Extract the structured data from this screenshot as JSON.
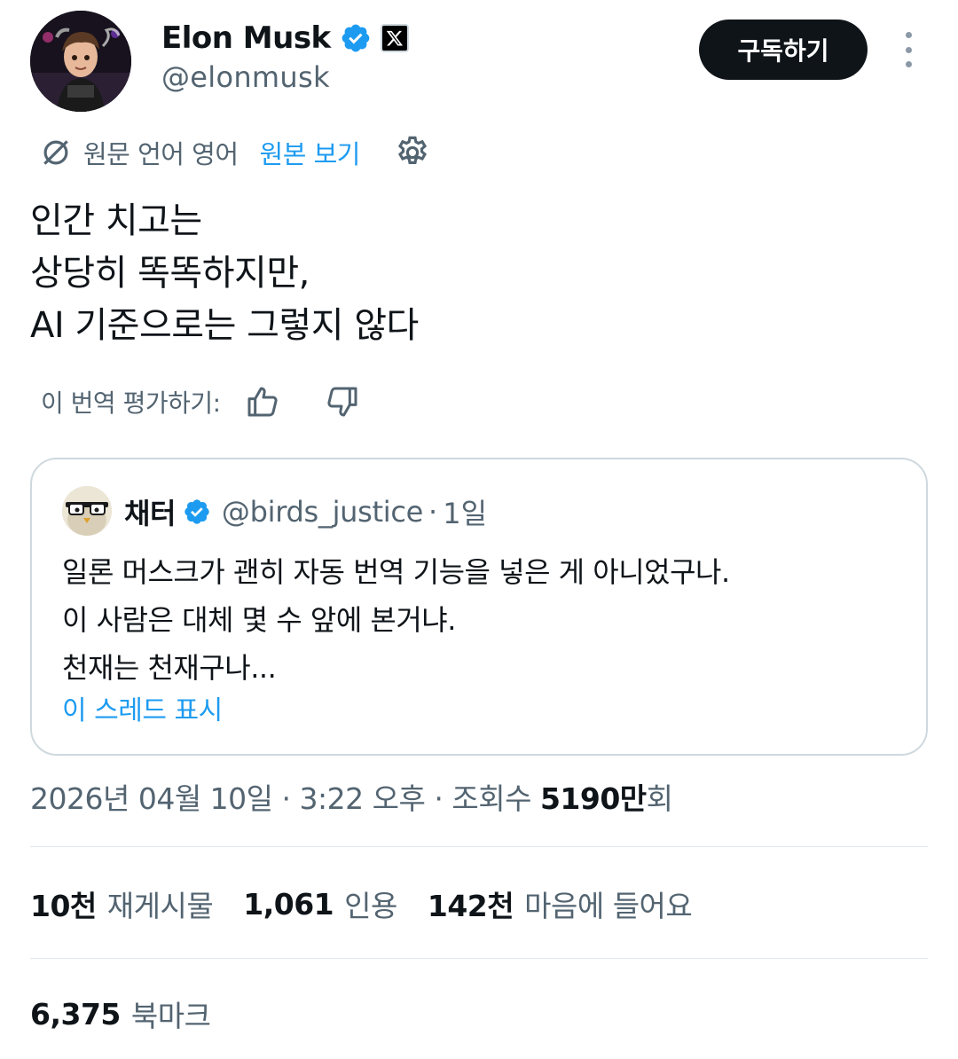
{
  "author": {
    "name": "Elon Musk",
    "handle": "@elonmusk",
    "verified": true,
    "affiliate_badge": "x-logo-icon"
  },
  "header": {
    "subscribe_label": "구독하기",
    "more_icon": "more-vertical-icon"
  },
  "translation": {
    "source_language": "원문 언어 영어",
    "show_original": "원본 보기",
    "rate_label": "이 번역 평가하기:"
  },
  "tweet": {
    "lines": [
      "인간 치고는",
      "상당히 똑똑하지만,",
      "AI 기준으로는 그렇지 않다"
    ]
  },
  "quote": {
    "name": "채터",
    "handle": "@birds_justice",
    "separator": "·",
    "time": "1일",
    "verified": true,
    "lines": [
      "일론 머스크가 괜히 자동 번역 기능을 넣은 게 아니었구나.",
      "이 사람은 대체 몇 수 앞에 본거냐.",
      "천재는 천재구나..."
    ],
    "show_thread": "이 스레드 표시"
  },
  "meta": {
    "date": "2026년 04월 10일",
    "separator": "·",
    "time": "3:22 오후",
    "views_label": "조회수",
    "views_value": "5190만",
    "views_suffix": "회"
  },
  "stats": {
    "reposts_value": "10천",
    "reposts_label": "재게시물",
    "quotes_value": "1,061",
    "quotes_label": "인용",
    "likes_value": "142천",
    "likes_label": "마음에 들어요",
    "bookmarks_value": "6,375",
    "bookmarks_label": "북마크"
  },
  "colors": {
    "accent": "#1d9bf0",
    "text": "#0f1419",
    "secondary": "#536471",
    "border": "#cfd9de"
  }
}
